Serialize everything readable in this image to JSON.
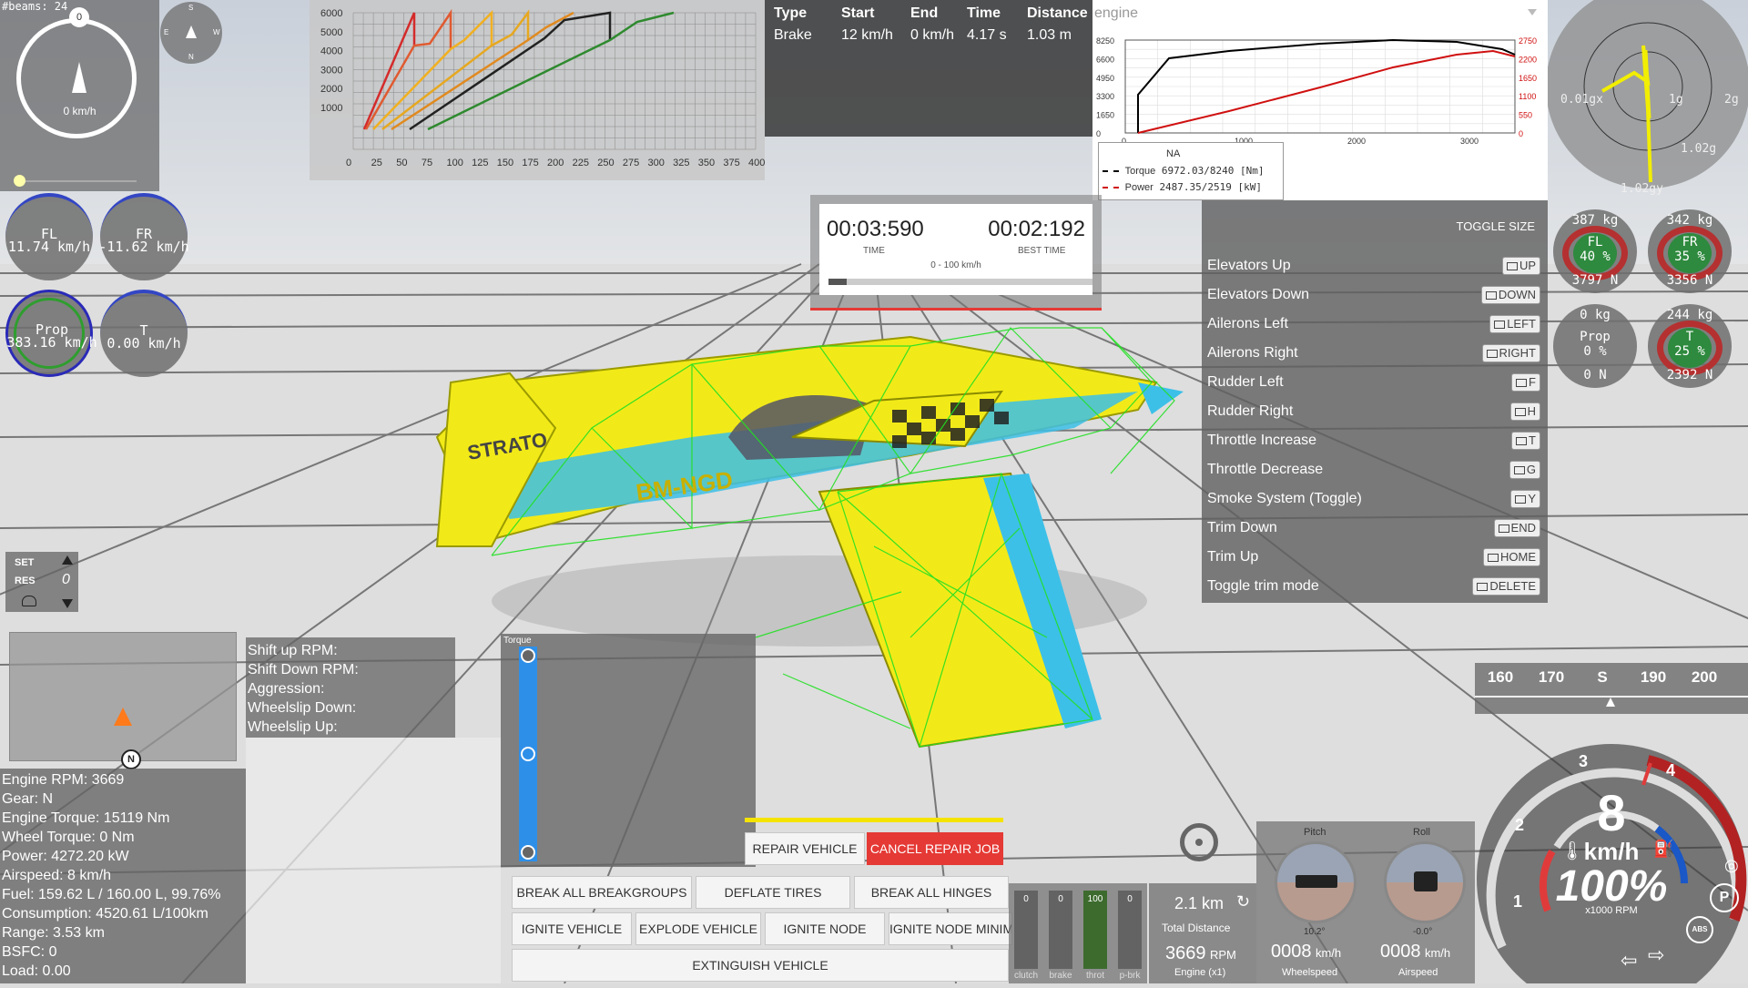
{
  "beams_label": "#beams: 24",
  "speedo_small": {
    "value": "0 km/h",
    "top_badge": "0"
  },
  "compass": {
    "n": "N",
    "s": "S",
    "e": "E",
    "w": "W"
  },
  "shift_chart": {
    "x_ticks": [
      "0",
      "25",
      "50",
      "75",
      "100",
      "125",
      "150",
      "175",
      "200",
      "225",
      "250",
      "275",
      "300",
      "325",
      "350",
      "375",
      "400"
    ],
    "y_ticks": [
      "6000",
      "5000",
      "4000",
      "3000",
      "2000",
      "1000"
    ]
  },
  "brake_table": {
    "headers": [
      "Type",
      "Start",
      "End",
      "Time",
      "Distance"
    ],
    "row": [
      "Brake",
      "12 km/h",
      "0 km/h",
      "4.17 s",
      "1.03 m"
    ]
  },
  "engine_graph": {
    "dropdown": "engine",
    "left_ticks": [
      "8250",
      "6600",
      "4950",
      "3300",
      "1650",
      "0"
    ],
    "right_ticks": [
      "2750",
      "2200",
      "1650",
      "1100",
      "550",
      "0"
    ],
    "x_ticks": [
      "0",
      "1000",
      "2000",
      "3000"
    ],
    "legend_title": "NA",
    "torque_label": "Torque",
    "torque_value": "6972.03/8240 [Nm]",
    "power_label": "Power",
    "power_value": "2487.35/2519 [kW]",
    "colors": {
      "torque": "#000000",
      "power": "#d01010"
    }
  },
  "lap_timer": {
    "time": "00:03:590",
    "time_label": "TIME",
    "best": "00:02:192",
    "best_label": "BEST TIME",
    "mode": "0 - 100 km/h",
    "progress": 0.07
  },
  "wheels_left": [
    {
      "name": "FL",
      "value": "11.74 km/h"
    },
    {
      "name": "FR",
      "value": "-11.62 km/h"
    },
    {
      "name": "Prop",
      "value": "383.16 km/h"
    },
    {
      "name": "T",
      "value": "0.00 km/h"
    }
  ],
  "controls": {
    "toggle": "TOGGLE SIZE",
    "items": [
      {
        "label": "Elevators Up",
        "key": "UP"
      },
      {
        "label": "Elevators Down",
        "key": "DOWN"
      },
      {
        "label": "Ailerons Left",
        "key": "LEFT"
      },
      {
        "label": "Ailerons Right",
        "key": "RIGHT"
      },
      {
        "label": "Rudder Left",
        "key": "F"
      },
      {
        "label": "Rudder Right",
        "key": "H"
      },
      {
        "label": "Throttle Increase",
        "key": "T"
      },
      {
        "label": "Throttle Decrease",
        "key": "G"
      },
      {
        "label": "Smoke System (Toggle)",
        "key": "Y"
      },
      {
        "label": "Trim Down",
        "key": "END"
      },
      {
        "label": "Trim Up",
        "key": "HOME"
      },
      {
        "label": "Toggle trim mode",
        "key": "DELETE"
      }
    ]
  },
  "gforce": {
    "a": "0.01gx",
    "b": "1g",
    "c": "2g",
    "d": "1.02g",
    "e": "1.02gy"
  },
  "tire_forces": [
    {
      "top": "387 kg",
      "name": "FL",
      "pct": "40 %",
      "bottom": "3797 N"
    },
    {
      "top": "342 kg",
      "name": "FR",
      "pct": "35 %",
      "bottom": "3356 N"
    },
    {
      "top": "0 kg",
      "name": "Prop",
      "pct": "0 %",
      "bottom": "0 N"
    },
    {
      "top": "244 kg",
      "name": "T",
      "pct": "25 %",
      "bottom": "2392 N"
    }
  ],
  "cruise": {
    "set": "SET",
    "res": "RES",
    "value": "0"
  },
  "minimap": {
    "north": "N"
  },
  "shift_info": [
    "Shift up RPM:",
    "Shift Down RPM:",
    "Aggression:",
    "Wheelslip Down:",
    "Wheelslip Up:"
  ],
  "engine_stats": [
    "Engine RPM: 3669",
    "Gear: N",
    "Engine Torque: 15119 Nm",
    "Wheel Torque: 0 Nm",
    "Power: 4272.20 kW",
    "Airspeed: 8 km/h",
    "Fuel: 159.62 L / 160.00 L, 99.76%",
    "Consumption: 4520.61 L/100km",
    "Range: 3.53 km",
    "BSFC: 0",
    "Load: 0.00"
  ],
  "torque_bar": {
    "label": "Torque"
  },
  "actions": {
    "repair": "REPAIR VEHICLE",
    "cancel": "CANCEL REPAIR JOB",
    "break_groups": "BREAK ALL BREAKGROUPS",
    "deflate": "DEFLATE TIRES",
    "break_hinges": "BREAK ALL HINGES",
    "ignite": "IGNITE VEHICLE",
    "explode": "EXPLODE VEHICLE",
    "ignite_node": "IGNITE NODE",
    "ignite_node_min": "IGNITE NODE MINIM",
    "extinguish": "EXTINGUISH VEHICLE"
  },
  "inputs": [
    {
      "label": "clutch",
      "value": "0",
      "fill": 0
    },
    {
      "label": "brake",
      "value": "0",
      "fill": 0
    },
    {
      "label": "throt",
      "value": "100",
      "fill": 1
    },
    {
      "label": "p-brk",
      "value": "0",
      "fill": 0
    }
  ],
  "trip": {
    "distance": "2.1 km",
    "label": "Total Distance"
  },
  "rpm_readout": {
    "value": "3669",
    "unit": "RPM",
    "label": "Engine (x1)"
  },
  "attitude": {
    "pitch_label": "Pitch",
    "pitch_value": "10.2°",
    "roll_label": "Roll",
    "roll_value": "-0.0°"
  },
  "wheelspeed": {
    "value": "0008",
    "unit": "km/h",
    "label": "Wheelspeed"
  },
  "airspeed": {
    "value": "0008",
    "unit": "km/h",
    "label": "Airspeed"
  },
  "heading": {
    "ticks": [
      "160",
      "170",
      "S",
      "190",
      "200"
    ]
  },
  "gauge": {
    "speed": "8",
    "unit": "km/h",
    "throttle": "100%",
    "rpm_label": "x1000 RPM",
    "ticks": [
      "1",
      "2",
      "3",
      "4"
    ],
    "p": "P",
    "abs": "ABS"
  },
  "aircraft": {
    "reg": "BM-NGD",
    "brand": "STRATO"
  }
}
